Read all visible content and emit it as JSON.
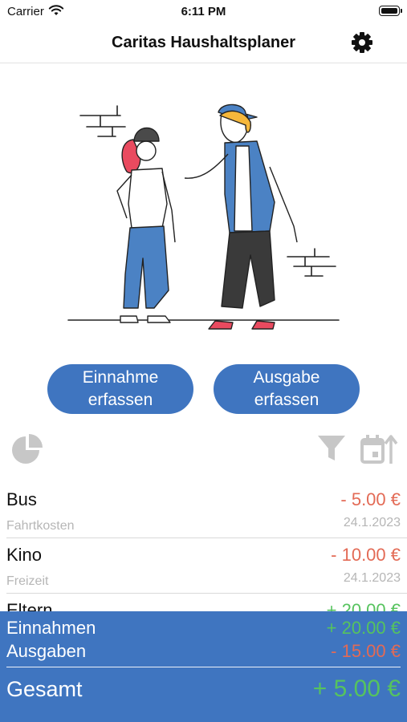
{
  "status": {
    "carrier": "Carrier",
    "time": "6:11 PM"
  },
  "nav": {
    "title": "Caritas Haushaltsplaner",
    "settings_icon": "gear-icon"
  },
  "actions": {
    "income_line1": "Einnahme",
    "income_line2": "erfassen",
    "expense_line1": "Ausgabe",
    "expense_line2": "erfassen"
  },
  "tools": {
    "chart_icon": "pie-chart-icon",
    "filter_icon": "filter-icon",
    "sort_icon": "calendar-sort-icon"
  },
  "transactions": [
    {
      "title": "Bus",
      "category": "Fahrtkosten",
      "amount": "- 5.00 €",
      "date": "24.1.2023",
      "type": "expense"
    },
    {
      "title": "Kino",
      "category": "Freizeit",
      "amount": "- 10.00 €",
      "date": "24.1.2023",
      "type": "expense"
    },
    {
      "title": "Eltern",
      "category": "",
      "amount": "+ 20.00 €",
      "date": "",
      "type": "income"
    }
  ],
  "summary": {
    "income_label": "Einnahmen",
    "income_value": "+ 20.00 €",
    "expense_label": "Ausgaben",
    "expense_value": "- 15.00 €",
    "total_label": "Gesamt",
    "total_value": "+ 5.00 €"
  },
  "colors": {
    "accent": "#3f75c0",
    "negative": "#e36a55",
    "positive": "#56c35e"
  }
}
